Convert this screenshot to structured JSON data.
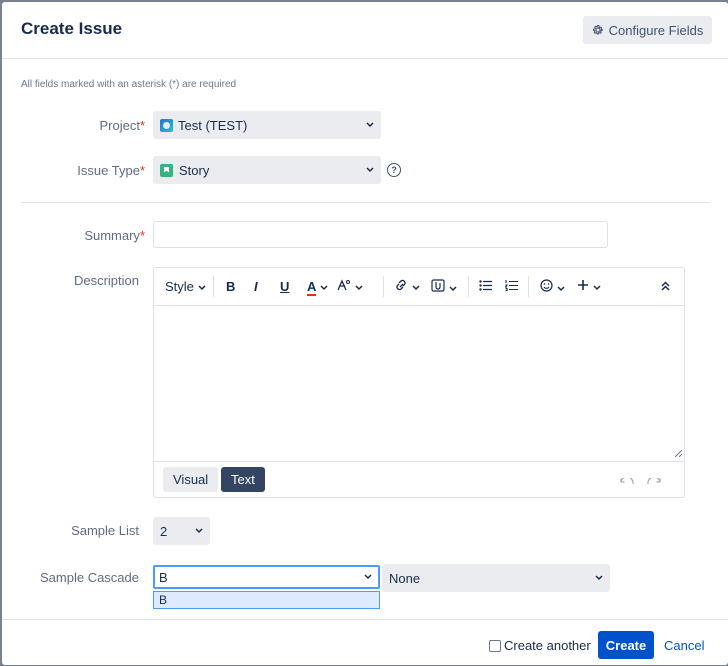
{
  "dialog": {
    "title": "Create Issue",
    "configure_fields_label": "Configure Fields",
    "required_note": "All fields marked with an asterisk (*) are required"
  },
  "fields": {
    "project": {
      "label": "Project",
      "value": "Test (TEST)"
    },
    "issue_type": {
      "label": "Issue Type",
      "value": "Story"
    },
    "summary": {
      "label": "Summary",
      "value": ""
    },
    "description": {
      "label": "Description"
    },
    "sample_list": {
      "label": "Sample List",
      "value": "2"
    },
    "sample_cascade": {
      "label": "Sample Cascade",
      "parent_value": "B",
      "child_value": "None",
      "dropdown_options": [
        "B"
      ]
    }
  },
  "editor": {
    "toolbar": {
      "style_label": "Style",
      "bold": "B",
      "italic": "I",
      "underline": "U",
      "text_color": "A"
    },
    "modes": {
      "visual": "Visual",
      "text": "Text",
      "active": "Text"
    }
  },
  "footer": {
    "create_another_label": "Create another",
    "create_another_checked": false,
    "create_label": "Create",
    "cancel_label": "Cancel"
  },
  "colors": {
    "primary": "#0052cc",
    "required_asterisk": "#de350b",
    "story_icon": "#36b37e",
    "text_mode_active": "#344563"
  }
}
